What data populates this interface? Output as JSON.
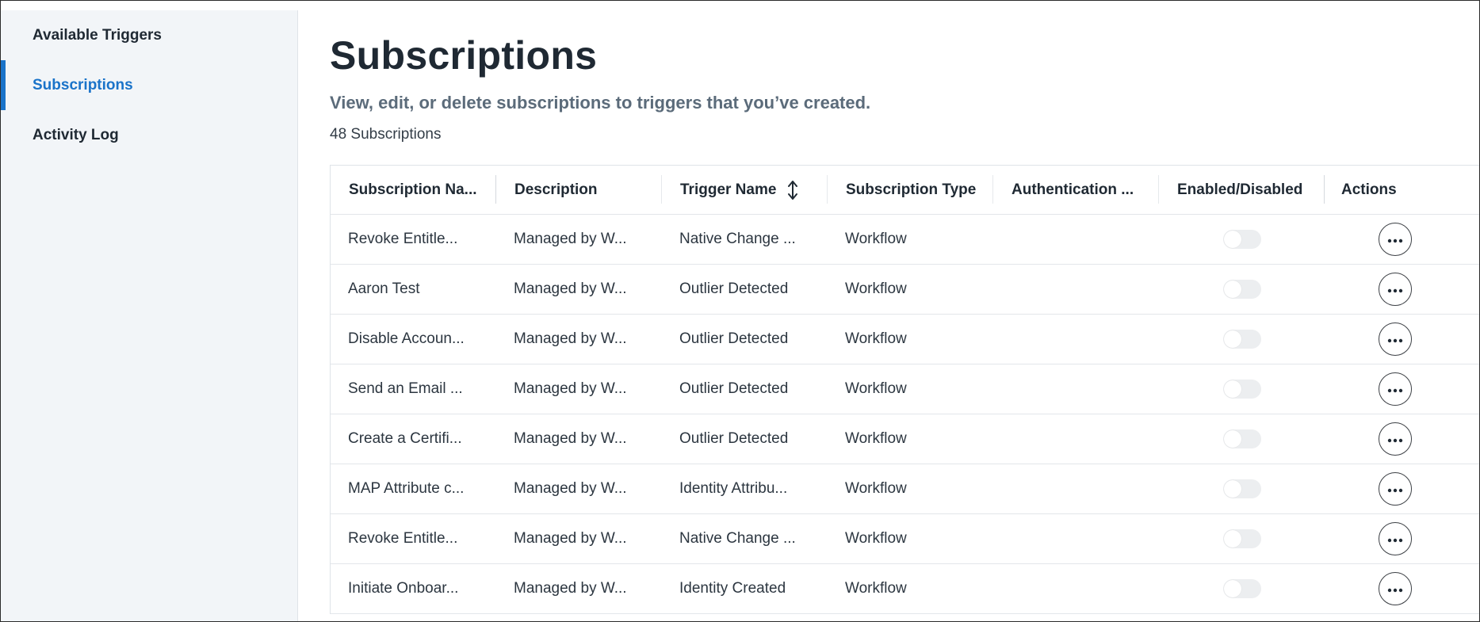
{
  "sidebar": {
    "items": [
      {
        "label": "Available Triggers",
        "active": false
      },
      {
        "label": "Subscriptions",
        "active": true
      },
      {
        "label": "Activity Log",
        "active": false
      }
    ]
  },
  "main": {
    "title": "Subscriptions",
    "subtitle": "View, edit, or delete subscriptions to triggers that you’ve created.",
    "count": "48 Subscriptions"
  },
  "table": {
    "columns": [
      "Subscription Na...",
      "Description",
      "Trigger Name",
      "Subscription Type",
      "Authentication ...",
      "Enabled/Disabled",
      "Actions"
    ],
    "rows": [
      {
        "name": "Revoke Entitle...",
        "description": "Managed by W...",
        "trigger": "Native Change ...",
        "type": "Workflow",
        "auth": "",
        "enabled": false
      },
      {
        "name": "Aaron Test",
        "description": "Managed by W...",
        "trigger": "Outlier Detected",
        "type": "Workflow",
        "auth": "",
        "enabled": false
      },
      {
        "name": "Disable Accoun...",
        "description": "Managed by W...",
        "trigger": "Outlier Detected",
        "type": "Workflow",
        "auth": "",
        "enabled": false
      },
      {
        "name": "Send an Email ...",
        "description": "Managed by W...",
        "trigger": "Outlier Detected",
        "type": "Workflow",
        "auth": "",
        "enabled": false
      },
      {
        "name": "Create a Certifi...",
        "description": "Managed by W...",
        "trigger": "Outlier Detected",
        "type": "Workflow",
        "auth": "",
        "enabled": false
      },
      {
        "name": "MAP Attribute c...",
        "description": "Managed by W...",
        "trigger": "Identity Attribu...",
        "type": "Workflow",
        "auth": "",
        "enabled": false
      },
      {
        "name": "Revoke Entitle...",
        "description": "Managed by W...",
        "trigger": "Native Change ...",
        "type": "Workflow",
        "auth": "",
        "enabled": false
      },
      {
        "name": "Initiate Onboar...",
        "description": "Managed by W...",
        "trigger": "Identity Created",
        "type": "Workflow",
        "auth": "",
        "enabled": false
      }
    ]
  },
  "icons": {
    "sort": "sort-arrows-icon",
    "more": "more-horizontal-icon"
  },
  "colors": {
    "accent": "#1a73c9",
    "sidebar_bg": "#f2f5f8",
    "subtitle": "#5b6b7a"
  }
}
